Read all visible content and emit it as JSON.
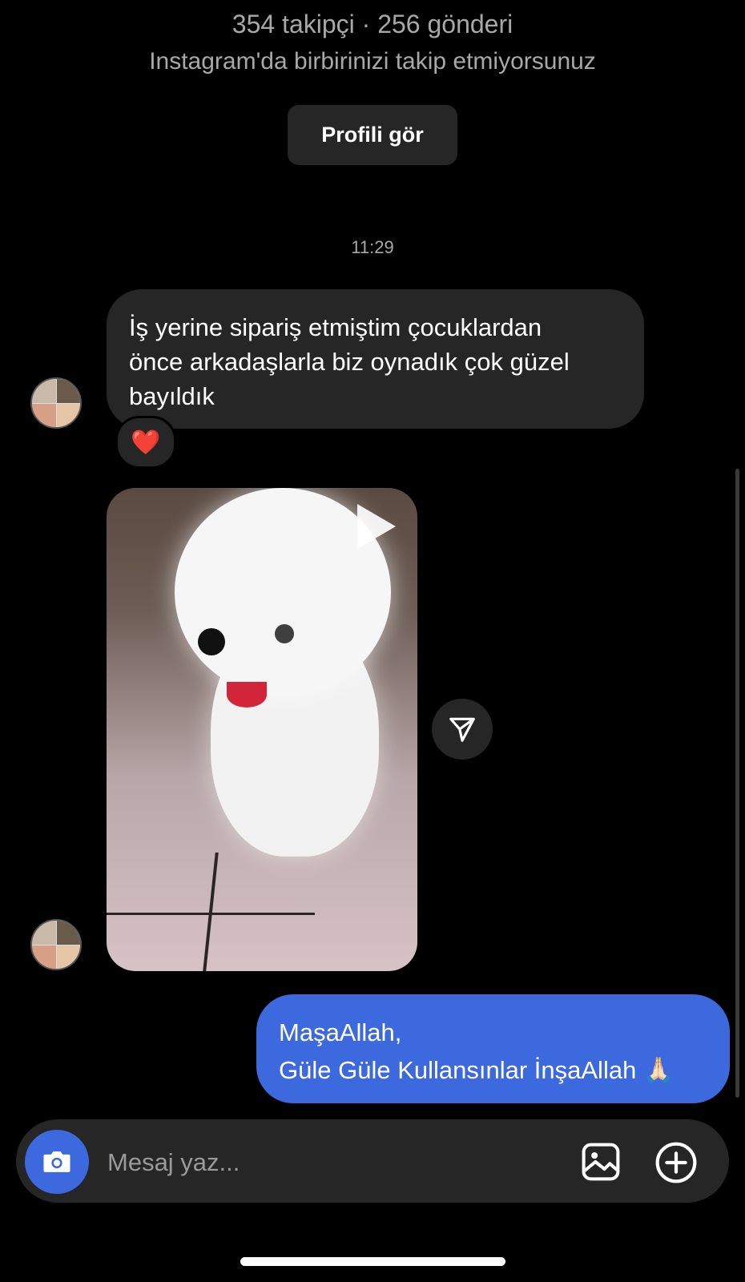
{
  "header": {
    "stats": "354 takipçi · 256 gönderi",
    "follow_note": "Instagram'da birbirinizi takip etmiyorsunuz",
    "profile_button": "Profili gör"
  },
  "thread": {
    "timestamp": "11:29",
    "incoming_message": {
      "lines": [
        "İş yerine sipariş etmiştim çocuklardan",
        "önce arkadaşlarla biz oynadık çok güzel",
        "bayıldık"
      ],
      "reaction": "❤️"
    },
    "video": {
      "icon": "play-icon"
    },
    "outgoing_message": {
      "lines": [
        "MaşaAllah,",
        "Güle Güle Kullansınlar İnşaAllah 🙏🏻"
      ]
    }
  },
  "composer": {
    "placeholder": "Mesaj yaz...",
    "icons": [
      "camera-icon",
      "gallery-icon",
      "plus-circle-icon"
    ]
  },
  "colors": {
    "background": "#000000",
    "incoming_bubble": "#262626",
    "outgoing_bubble": "#3d69de",
    "muted_text": "#a8a8a8"
  }
}
